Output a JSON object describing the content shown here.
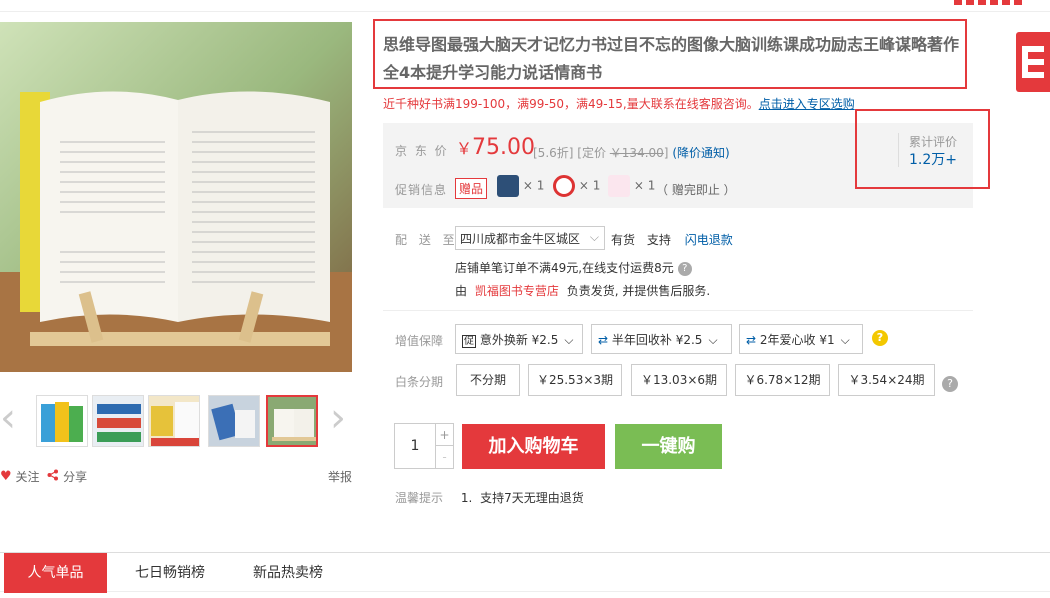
{
  "title": "思维导图最强大脑天才记忆力书过目不忘的图像大脑训练课成功励志王峰谋略著作全4本提升学习能力说话情商书",
  "promo": {
    "text": "近千种好书满199-100，满99-50，满49-15,量大联系在线客服咨询。",
    "link": "点击进入专区选购"
  },
  "price": {
    "label": "京 东 价",
    "currency": "￥",
    "amount": "75.00",
    "discount": "[5.6折]",
    "list_label": "[定价",
    "list_price": "￥134.00",
    "list_close": "]",
    "notify": "(降价通知)"
  },
  "evaluation": {
    "label": "累计评价",
    "count": "1.2万+"
  },
  "promotion": {
    "label": "促销信息",
    "tag": "赠品",
    "gifts": [
      "× 1",
      "× 1",
      "× 1"
    ],
    "end_note": "（ 赠完即止 ）"
  },
  "delivery": {
    "label": "配 送 至",
    "region": "四川成都市金牛区城区",
    "stock": "有货",
    "support": "支持",
    "flash_refund": "闪电退款",
    "shipping_note": "店铺单笔订单不满49元,在线支付运费8元",
    "seller_prefix": "由",
    "seller": "凯福图书专营店",
    "seller_suffix": "负责发货, 并提供售后服务."
  },
  "value_add": {
    "label": "增值保障",
    "options": [
      "意外换新 ¥2.5",
      "半年回收补 ¥2.5",
      "2年爱心收 ¥1"
    ],
    "help": "?"
  },
  "installment": {
    "label": "白条分期",
    "options": [
      "不分期",
      "￥25.53×3期",
      "￥13.03×6期",
      "￥6.78×12期",
      "￥3.54×24期"
    ],
    "help": "?"
  },
  "buy": {
    "quantity": "1",
    "plus": "+",
    "minus": "-",
    "add_to_cart": "加入购物车",
    "one_click": "一键购"
  },
  "tips": {
    "label": "温馨提示",
    "index": "1.",
    "text": "支持7天无理由退货"
  },
  "gallery": {
    "prev": "‹",
    "next": "›",
    "follow": "关注",
    "share": "分享",
    "report": "举报",
    "selected_thumb": 5
  },
  "tabs": [
    "人气单品",
    "七日畅销榜",
    "新品热卖榜"
  ],
  "colors": {
    "accent": "#e4393c",
    "link": "#005ea7",
    "buy_green": "#7abd54"
  }
}
